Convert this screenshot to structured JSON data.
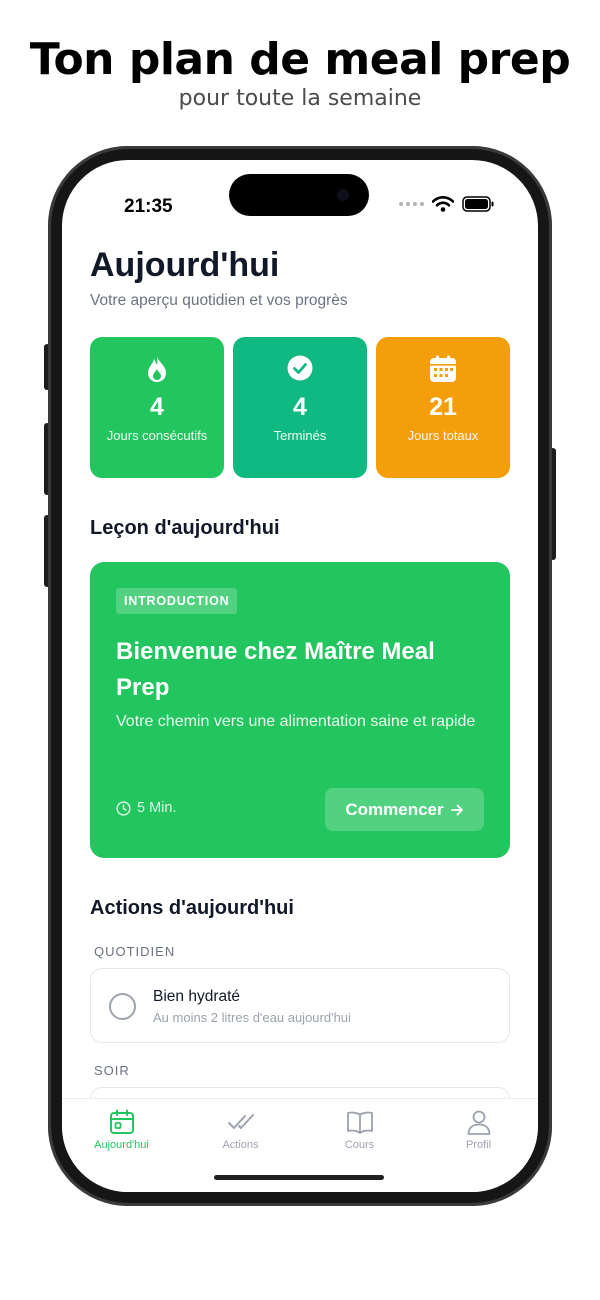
{
  "promo": {
    "title": "Ton plan de meal prep",
    "subtitle": "pour toute la semaine"
  },
  "status_bar": {
    "time": "21:35",
    "icons": [
      "signal-dots-icon",
      "wifi-icon",
      "battery-icon"
    ]
  },
  "header": {
    "title": "Aujourd'hui",
    "subtitle": "Votre aperçu quotidien et vos progrès"
  },
  "stats": [
    {
      "icon": "flame-icon",
      "value": "4",
      "label": "Jours consécutifs",
      "color": "#22c55e"
    },
    {
      "icon": "check-circle-icon",
      "value": "4",
      "label": "Terminés",
      "color": "#10b981"
    },
    {
      "icon": "calendar-icon",
      "value": "21",
      "label": "Jours totaux",
      "color": "#f59e0b"
    }
  ],
  "lesson": {
    "section_title": "Leçon d'aujourd'hui",
    "badge": "INTRODUCTION",
    "title": "Bienvenue chez Maître Meal Prep",
    "description": "Votre chemin vers une alimentation saine et rapide",
    "duration": "5 Min.",
    "button_label": "Commencer",
    "color": "#22c55e"
  },
  "actions": {
    "section_title": "Actions d'aujourd'hui",
    "groups": [
      {
        "label": "QUOTIDIEN",
        "items": [
          {
            "name": "Bien hydraté",
            "description": "Au moins 2 litres d'eau aujourd'hui",
            "done": false
          }
        ]
      },
      {
        "label": "SOIR",
        "items": []
      }
    ]
  },
  "tabbar": {
    "active_color": "#22c55e",
    "tabs": [
      {
        "label": "Aujourd'hui",
        "icon": "calendar-icon",
        "active": true
      },
      {
        "label": "Actions",
        "icon": "double-check-icon",
        "active": false
      },
      {
        "label": "Cours",
        "icon": "book-icon",
        "active": false
      },
      {
        "label": "Profil",
        "icon": "person-icon",
        "active": false
      }
    ]
  }
}
